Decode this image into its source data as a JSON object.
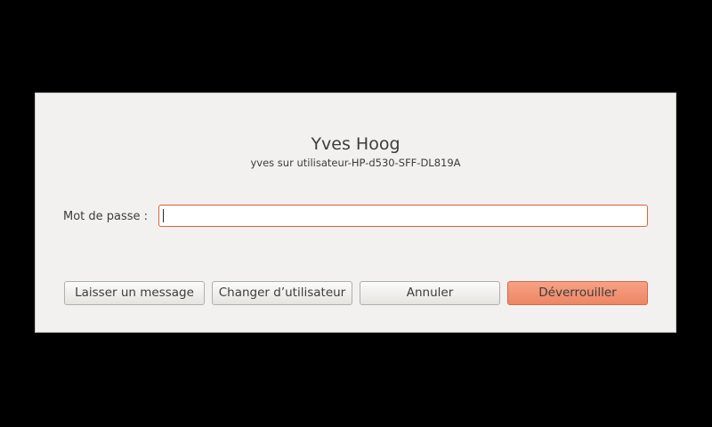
{
  "dialog": {
    "user_name": "Yves Hoog",
    "host_line": "yves sur utilisateur-HP-d530-SFF-DL819A",
    "password_label": "Mot de passe :",
    "password_value": ""
  },
  "buttons": {
    "leave_message": "Laisser un message",
    "switch_user": "Changer d’utilisateur",
    "cancel": "Annuler",
    "unlock": "Déverrouiller"
  },
  "colors": {
    "accent": "#e2623a",
    "unlock_button": "#f19a7a",
    "dialog_bg": "#f2f1f0",
    "backdrop": "#000000"
  }
}
